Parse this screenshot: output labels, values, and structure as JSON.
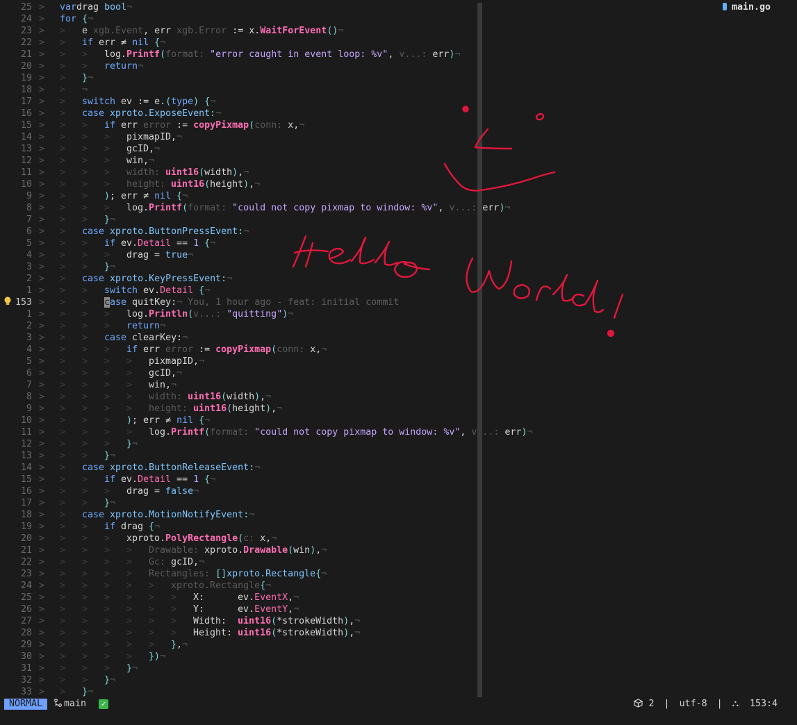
{
  "file_tab": {
    "name": "main.go",
    "icon": "go-file-icon"
  },
  "blame": "You, 1 hour ago - feat: initial commit",
  "handwriting": {
    "text": "Hello World!",
    "color": "#e0173c"
  },
  "statusline": {
    "mode": "NORMAL",
    "branch": "main",
    "diagnostics": "2",
    "encoding": "utf-8",
    "position": "153:4",
    "separator": "|"
  },
  "colors": {
    "background": "#1b1b1b",
    "mode_bg": "#6ea0ff",
    "ink": "#e0173c"
  },
  "lines": [
    {
      "n": "25",
      "d": 0,
      "s": [
        [
          "k",
          "var"
        ],
        [
          "",
          "drag "
        ],
        [
          "t",
          "bool"
        ]
      ]
    },
    {
      "n": "24",
      "d": 0,
      "s": [
        [
          "k",
          "for"
        ],
        [
          "p",
          " {"
        ]
      ]
    },
    {
      "n": "23",
      "d": 1,
      "s": [
        [
          "",
          "e "
        ],
        [
          "h",
          "xgb.Event"
        ],
        [
          "",
          ", err "
        ],
        [
          "h",
          "xgb.Error"
        ],
        [
          "op",
          " := "
        ],
        [
          "pkg",
          "x."
        ],
        [
          "f",
          "WaitForEvent"
        ],
        [
          "p",
          "()"
        ]
      ]
    },
    {
      "n": "22",
      "d": 1,
      "s": [
        [
          "k",
          "if"
        ],
        [
          "",
          " err "
        ],
        [
          "op",
          "≠"
        ],
        [
          "k",
          " nil"
        ],
        [
          "p",
          " {"
        ]
      ]
    },
    {
      "n": "21",
      "d": 2,
      "s": [
        [
          "",
          "log."
        ],
        [
          "f",
          "Printf"
        ],
        [
          "p",
          "("
        ],
        [
          "h",
          "format: "
        ],
        [
          "s",
          "\"error caught in event loop: %v\""
        ],
        [
          "",
          ", "
        ],
        [
          "h",
          "v...: "
        ],
        [
          "",
          "err"
        ],
        [
          "p",
          ")"
        ]
      ]
    },
    {
      "n": "20",
      "d": 2,
      "s": [
        [
          "k",
          "return"
        ]
      ]
    },
    {
      "n": "19",
      "d": 1,
      "s": [
        [
          "p",
          "}"
        ]
      ]
    },
    {
      "n": "18",
      "d": 1,
      "s": []
    },
    {
      "n": "17",
      "d": 1,
      "s": [
        [
          "k",
          "switch"
        ],
        [
          "",
          " ev "
        ],
        [
          "op",
          ":="
        ],
        [
          "",
          " e."
        ],
        [
          "p",
          "("
        ],
        [
          "k",
          "type"
        ],
        [
          "p",
          ")"
        ],
        [
          "p",
          " {"
        ]
      ]
    },
    {
      "n": "16",
      "d": 1,
      "s": [
        [
          "k",
          "case"
        ],
        [
          "",
          " "
        ],
        [
          "t",
          "xproto.ExposeEvent"
        ],
        [
          "p",
          ":"
        ]
      ]
    },
    {
      "n": "15",
      "d": 2,
      "s": [
        [
          "k",
          "if"
        ],
        [
          "",
          " err "
        ],
        [
          "h",
          "error"
        ],
        [
          "op",
          " := "
        ],
        [
          "f",
          "copyPixmap"
        ],
        [
          "p",
          "("
        ],
        [
          "h",
          "conn: "
        ],
        [
          "",
          "x,"
        ]
      ]
    },
    {
      "n": "14",
      "d": 3,
      "s": [
        [
          "",
          "pixmapID,"
        ]
      ]
    },
    {
      "n": "13",
      "d": 3,
      "s": [
        [
          "",
          "gcID,"
        ]
      ]
    },
    {
      "n": "12",
      "d": 3,
      "s": [
        [
          "",
          "win,"
        ]
      ]
    },
    {
      "n": "11",
      "d": 3,
      "s": [
        [
          "h",
          "width: "
        ],
        [
          "b",
          "uint16"
        ],
        [
          "p",
          "("
        ],
        [
          "",
          "width"
        ],
        [
          "p",
          ")"
        ],
        [
          "",
          ","
        ]
      ]
    },
    {
      "n": "10",
      "d": 3,
      "s": [
        [
          "h",
          "height: "
        ],
        [
          "b",
          "uint16"
        ],
        [
          "p",
          "("
        ],
        [
          "",
          "height"
        ],
        [
          "p",
          ")"
        ],
        [
          "",
          ","
        ]
      ]
    },
    {
      "n": "9",
      "d": 2,
      "s": [
        [
          "p",
          ")"
        ],
        [
          "",
          "; err "
        ],
        [
          "op",
          "≠"
        ],
        [
          "k",
          " nil"
        ],
        [
          "p",
          " {"
        ]
      ]
    },
    {
      "n": "8",
      "d": 3,
      "s": [
        [
          "",
          "log."
        ],
        [
          "f",
          "Printf"
        ],
        [
          "p",
          "("
        ],
        [
          "h",
          "format: "
        ],
        [
          "s",
          "\"could not copy pixmap to window: %v\""
        ],
        [
          "",
          ", "
        ],
        [
          "h",
          "v...: "
        ],
        [
          "",
          "err"
        ],
        [
          "p",
          ")"
        ]
      ]
    },
    {
      "n": "7",
      "d": 2,
      "s": [
        [
          "p",
          "}"
        ]
      ]
    },
    {
      "n": "6",
      "d": 1,
      "s": [
        [
          "k",
          "case"
        ],
        [
          "",
          " "
        ],
        [
          "t",
          "xproto.ButtonPressEvent"
        ],
        [
          "p",
          ":"
        ]
      ]
    },
    {
      "n": "5",
      "d": 2,
      "s": [
        [
          "k",
          "if"
        ],
        [
          "",
          " ev."
        ],
        [
          "fl",
          "Detail"
        ],
        [
          "op",
          " == "
        ],
        [
          "n",
          "1"
        ],
        [
          "p",
          " {"
        ]
      ]
    },
    {
      "n": "4",
      "d": 3,
      "s": [
        [
          "",
          "drag "
        ],
        [
          "op",
          "="
        ],
        [
          "t",
          " true"
        ]
      ]
    },
    {
      "n": "3",
      "d": 2,
      "s": [
        [
          "p",
          "}"
        ]
      ]
    },
    {
      "n": "2",
      "d": 1,
      "s": [
        [
          "k",
          "case"
        ],
        [
          "",
          " "
        ],
        [
          "t",
          "xproto.KeyPressEvent"
        ],
        [
          "p",
          ":"
        ]
      ]
    },
    {
      "n": "1",
      "d": 2,
      "s": [
        [
          "k",
          "switch"
        ],
        [
          "",
          " ev."
        ],
        [
          "fl",
          "Detail"
        ],
        [
          "p",
          " {"
        ]
      ]
    },
    {
      "n": "153",
      "d": 2,
      "cur": true,
      "s": [
        [
          "cursor",
          "c"
        ],
        [
          "k",
          "ase"
        ],
        [
          "",
          " quitKey:"
        ]
      ]
    },
    {
      "n": "1",
      "d": 3,
      "s": [
        [
          "",
          "log."
        ],
        [
          "f",
          "Println"
        ],
        [
          "p",
          "("
        ],
        [
          "h",
          "v...: "
        ],
        [
          "s",
          "\"quitting\""
        ],
        [
          "p",
          ")"
        ]
      ]
    },
    {
      "n": "2",
      "d": 3,
      "s": [
        [
          "k",
          "return"
        ]
      ]
    },
    {
      "n": "3",
      "d": 2,
      "s": [
        [
          "k",
          "case"
        ],
        [
          "",
          " clearKey:"
        ]
      ]
    },
    {
      "n": "4",
      "d": 3,
      "s": [
        [
          "k",
          "if"
        ],
        [
          "",
          " err "
        ],
        [
          "h",
          "error"
        ],
        [
          "op",
          " := "
        ],
        [
          "f",
          "copyPixmap"
        ],
        [
          "p",
          "("
        ],
        [
          "h",
          "conn: "
        ],
        [
          "",
          "x,"
        ]
      ]
    },
    {
      "n": "5",
      "d": 4,
      "s": [
        [
          "",
          "pixmapID,"
        ]
      ]
    },
    {
      "n": "6",
      "d": 4,
      "s": [
        [
          "",
          "gcID,"
        ]
      ]
    },
    {
      "n": "7",
      "d": 4,
      "s": [
        [
          "",
          "win,"
        ]
      ]
    },
    {
      "n": "8",
      "d": 4,
      "s": [
        [
          "h",
          "width: "
        ],
        [
          "b",
          "uint16"
        ],
        [
          "p",
          "("
        ],
        [
          "",
          "width"
        ],
        [
          "p",
          ")"
        ],
        [
          "",
          ","
        ]
      ]
    },
    {
      "n": "9",
      "d": 4,
      "s": [
        [
          "h",
          "height: "
        ],
        [
          "b",
          "uint16"
        ],
        [
          "p",
          "("
        ],
        [
          "",
          "height"
        ],
        [
          "p",
          ")"
        ],
        [
          "",
          ","
        ]
      ]
    },
    {
      "n": "10",
      "d": 3,
      "s": [
        [
          "p",
          ")"
        ],
        [
          "",
          "; err "
        ],
        [
          "op",
          "≠"
        ],
        [
          "k",
          " nil"
        ],
        [
          "p",
          " {"
        ]
      ]
    },
    {
      "n": "11",
      "d": 4,
      "s": [
        [
          "",
          "log."
        ],
        [
          "f",
          "Printf"
        ],
        [
          "p",
          "("
        ],
        [
          "h",
          "format: "
        ],
        [
          "s",
          "\"could not copy pixmap to window: %v\""
        ],
        [
          "",
          ", "
        ],
        [
          "h",
          "v...: "
        ],
        [
          "",
          "err"
        ],
        [
          "p",
          ")"
        ]
      ]
    },
    {
      "n": "12",
      "d": 3,
      "s": [
        [
          "p",
          "}"
        ]
      ]
    },
    {
      "n": "13",
      "d": 2,
      "s": [
        [
          "p",
          "}"
        ]
      ]
    },
    {
      "n": "14",
      "d": 1,
      "s": [
        [
          "k",
          "case"
        ],
        [
          "",
          " "
        ],
        [
          "t",
          "xproto.ButtonReleaseEvent"
        ],
        [
          "p",
          ":"
        ]
      ]
    },
    {
      "n": "15",
      "d": 2,
      "s": [
        [
          "k",
          "if"
        ],
        [
          "",
          " ev."
        ],
        [
          "fl",
          "Detail"
        ],
        [
          "op",
          " == "
        ],
        [
          "n",
          "1"
        ],
        [
          "p",
          " {"
        ]
      ]
    },
    {
      "n": "16",
      "d": 3,
      "s": [
        [
          "",
          "drag "
        ],
        [
          "op",
          "="
        ],
        [
          "t",
          " false"
        ]
      ]
    },
    {
      "n": "17",
      "d": 2,
      "s": [
        [
          "p",
          "}"
        ]
      ]
    },
    {
      "n": "18",
      "d": 1,
      "s": [
        [
          "k",
          "case"
        ],
        [
          "",
          " "
        ],
        [
          "t",
          "xproto.MotionNotifyEvent"
        ],
        [
          "p",
          ":"
        ]
      ]
    },
    {
      "n": "19",
      "d": 2,
      "s": [
        [
          "k",
          "if"
        ],
        [
          "",
          " drag"
        ],
        [
          "p",
          " {"
        ]
      ]
    },
    {
      "n": "20",
      "d": 3,
      "s": [
        [
          "",
          "xproto."
        ],
        [
          "f",
          "PolyRectangle"
        ],
        [
          "p",
          "("
        ],
        [
          "h",
          "c: "
        ],
        [
          "",
          "x,"
        ]
      ]
    },
    {
      "n": "21",
      "d": 4,
      "s": [
        [
          "h",
          "Drawable: "
        ],
        [
          "",
          "xproto."
        ],
        [
          "f",
          "Drawable"
        ],
        [
          "p",
          "("
        ],
        [
          "",
          "win"
        ],
        [
          "p",
          ")"
        ],
        [
          "",
          ","
        ]
      ]
    },
    {
      "n": "22",
      "d": 4,
      "s": [
        [
          "h",
          "Gc: "
        ],
        [
          "",
          "gcID,"
        ]
      ]
    },
    {
      "n": "23",
      "d": 4,
      "s": [
        [
          "h",
          "Rectangles: "
        ],
        [
          "p",
          "[]"
        ],
        [
          "t",
          "xproto.Rectangle"
        ],
        [
          "p",
          "{"
        ]
      ]
    },
    {
      "n": "24",
      "d": 5,
      "s": [
        [
          "h",
          "xproto.Rectangle"
        ],
        [
          "p",
          "{"
        ]
      ]
    },
    {
      "n": "25",
      "d": 6,
      "s": [
        [
          "",
          "X:      ev."
        ],
        [
          "fl",
          "EventX"
        ],
        [
          "",
          ","
        ]
      ]
    },
    {
      "n": "26",
      "d": 6,
      "s": [
        [
          "",
          "Y:      ev."
        ],
        [
          "fl",
          "EventY"
        ],
        [
          "",
          ","
        ]
      ]
    },
    {
      "n": "27",
      "d": 6,
      "s": [
        [
          "",
          "Width:  "
        ],
        [
          "b",
          "uint16"
        ],
        [
          "p",
          "("
        ],
        [
          "op",
          "*"
        ],
        [
          "",
          "strokeWidth"
        ],
        [
          "p",
          ")"
        ],
        [
          "",
          ","
        ]
      ]
    },
    {
      "n": "28",
      "d": 6,
      "s": [
        [
          "",
          "Height: "
        ],
        [
          "b",
          "uint16"
        ],
        [
          "p",
          "("
        ],
        [
          "op",
          "*"
        ],
        [
          "",
          "strokeWidth"
        ],
        [
          "p",
          ")"
        ],
        [
          "",
          ","
        ]
      ]
    },
    {
      "n": "29",
      "d": 5,
      "s": [
        [
          "p",
          "}"
        ],
        [
          "",
          ","
        ]
      ]
    },
    {
      "n": "30",
      "d": 4,
      "s": [
        [
          "p",
          "})"
        ]
      ]
    },
    {
      "n": "31",
      "d": 3,
      "s": [
        [
          "p",
          "}"
        ]
      ]
    },
    {
      "n": "32",
      "d": 2,
      "s": [
        [
          "p",
          "}"
        ]
      ]
    },
    {
      "n": "33",
      "d": 1,
      "s": [
        [
          "p",
          "}"
        ]
      ]
    }
  ]
}
